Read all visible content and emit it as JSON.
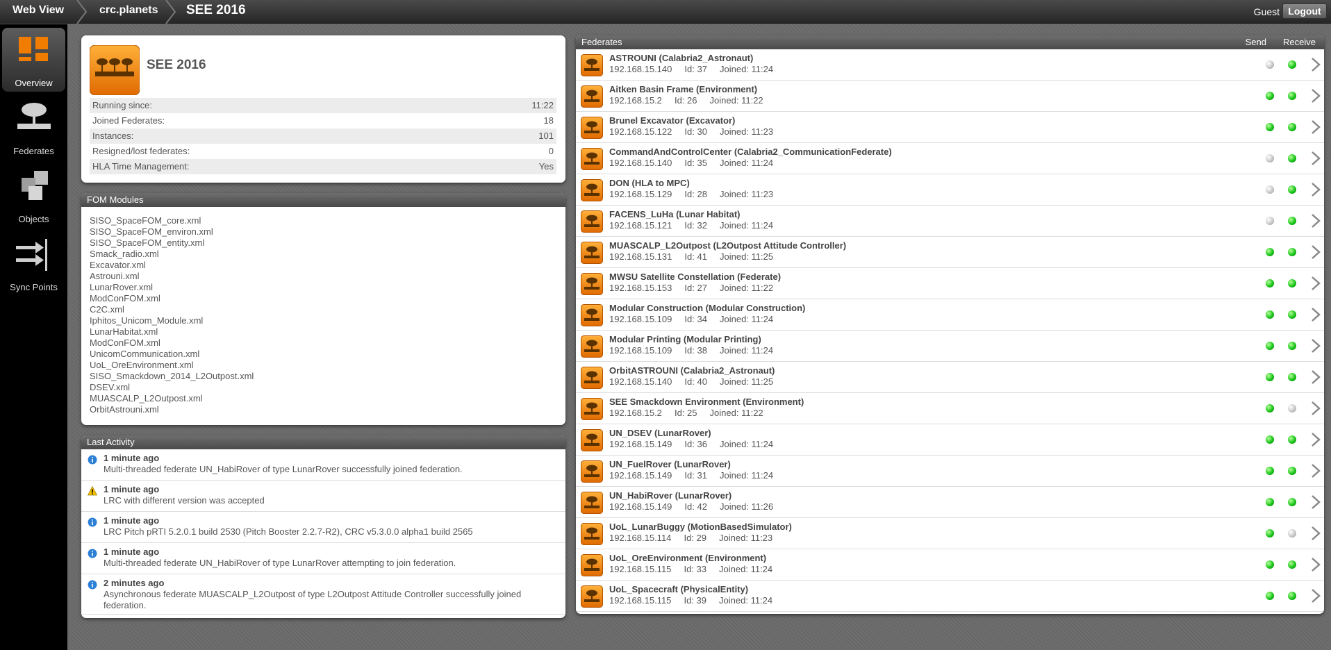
{
  "header": {
    "breadcrumbs": [
      "Web View",
      "crc.planets",
      "SEE 2016"
    ],
    "user_label": "Guest",
    "logout_label": "Logout"
  },
  "sidebar": {
    "items": [
      {
        "label": "Overview",
        "icon": "overview-icon",
        "active": true
      },
      {
        "label": "Federates",
        "icon": "federate-icon",
        "active": false
      },
      {
        "label": "Objects",
        "icon": "objects-icon",
        "active": false
      },
      {
        "label": "Sync Points",
        "icon": "sync-points-icon",
        "active": false
      }
    ]
  },
  "summary": {
    "title": "SEE 2016",
    "stats": [
      {
        "label": "Running since:",
        "value": "11:22"
      },
      {
        "label": "Joined Federates:",
        "value": "18"
      },
      {
        "label": "Instances:",
        "value": "101"
      },
      {
        "label": "Resigned/lost federates:",
        "value": "0"
      },
      {
        "label": "HLA Time Management:",
        "value": "Yes"
      }
    ]
  },
  "fom": {
    "title": "FOM Modules",
    "modules": [
      "SISO_SpaceFOM_core.xml",
      "SISO_SpaceFOM_environ.xml",
      "SISO_SpaceFOM_entity.xml",
      "Smack_radio.xml",
      "Excavator.xml",
      "Astrouni.xml",
      "LunarRover.xml",
      "ModConFOM.xml",
      "C2C.xml",
      "Iphitos_Unicom_Module.xml",
      "LunarHabitat.xml",
      "ModConFOM.xml",
      "UnicomCommunication.xml",
      "UoL_OreEnvironment.xml",
      "SISO_Smackdown_2014_L2Outpost.xml",
      "DSEV.xml",
      "MUASCALP_L2Outpost.xml",
      "OrbitAstrouni.xml"
    ]
  },
  "activity": {
    "title": "Last Activity",
    "items": [
      {
        "type": "info",
        "time": "1 minute ago",
        "message": "Multi-threaded federate UN_HabiRover of type LunarRover successfully joined federation."
      },
      {
        "type": "warning",
        "time": "1 minute ago",
        "message": "LRC with different version was accepted"
      },
      {
        "type": "info",
        "time": "1 minute ago",
        "message": "LRC Pitch pRTI 5.2.0.1 build 2530 (Pitch Booster 2.2.7-R2), CRC v5.3.0.0 alpha1 build 2565"
      },
      {
        "type": "info",
        "time": "1 minute ago",
        "message": "Multi-threaded federate UN_HabiRover of type LunarRover attempting to join federation."
      },
      {
        "type": "info",
        "time": "2 minutes ago",
        "message": "Asynchronous federate MUASCALP_L2Outpost of type L2Outpost Attitude Controller successfully joined federation."
      }
    ]
  },
  "federates": {
    "title": "Federates",
    "send_label": "Send",
    "receive_label": "Receive",
    "items": [
      {
        "name": "ASTROUNI (Calabria2_Astronaut)",
        "details": "192.168.15.140     Id: 37     Joined: 11:24",
        "send": "gray",
        "receive": "green"
      },
      {
        "name": "Aitken Basin Frame (Environment)",
        "details": "192.168.15.2     Id: 26     Joined: 11:22",
        "send": "green",
        "receive": "green"
      },
      {
        "name": "Brunel Excavator (Excavator)",
        "details": "192.168.15.122     Id: 30     Joined: 11:23",
        "send": "green",
        "receive": "green"
      },
      {
        "name": "CommandAndControlCenter (Calabria2_CommunicationFederate)",
        "details": "192.168.15.140     Id: 35     Joined: 11:24",
        "send": "gray",
        "receive": "green"
      },
      {
        "name": "DON (HLA to MPC)",
        "details": "192.168.15.129     Id: 28     Joined: 11:23",
        "send": "gray",
        "receive": "green"
      },
      {
        "name": "FACENS_LuHa (Lunar Habitat)",
        "details": "192.168.15.121     Id: 32     Joined: 11:24",
        "send": "gray",
        "receive": "green"
      },
      {
        "name": "MUASCALP_L2Outpost (L2Outpost Attitude Controller)",
        "details": "192.168.15.131     Id: 41     Joined: 11:25",
        "send": "green",
        "receive": "green"
      },
      {
        "name": "MWSU Satellite Constellation (Federate)",
        "details": "192.168.15.153     Id: 27     Joined: 11:22",
        "send": "green",
        "receive": "green"
      },
      {
        "name": "Modular Construction (Modular Construction)",
        "details": "192.168.15.109     Id: 34     Joined: 11:24",
        "send": "green",
        "receive": "green"
      },
      {
        "name": "Modular Printing (Modular Printing)",
        "details": "192.168.15.109     Id: 38     Joined: 11:24",
        "send": "green",
        "receive": "green"
      },
      {
        "name": "OrbitASTROUNI (Calabria2_Astronaut)",
        "details": "192.168.15.140     Id: 40     Joined: 11:25",
        "send": "green",
        "receive": "green"
      },
      {
        "name": "SEE Smackdown Environment (Environment)",
        "details": "192.168.15.2     Id: 25     Joined: 11:22",
        "send": "green",
        "receive": "gray"
      },
      {
        "name": "UN_DSEV (LunarRover)",
        "details": "192.168.15.149     Id: 36     Joined: 11:24",
        "send": "green",
        "receive": "green"
      },
      {
        "name": "UN_FuelRover (LunarRover)",
        "details": "192.168.15.149     Id: 31     Joined: 11:24",
        "send": "green",
        "receive": "green"
      },
      {
        "name": "UN_HabiRover (LunarRover)",
        "details": "192.168.15.149     Id: 42     Joined: 11:26",
        "send": "green",
        "receive": "green"
      },
      {
        "name": "UoL_LunarBuggy (MotionBasedSimulator)",
        "details": "192.168.15.114     Id: 29     Joined: 11:23",
        "send": "green",
        "receive": "gray"
      },
      {
        "name": "UoL_OreEnvironment (Environment)",
        "details": "192.168.15.115     Id: 33     Joined: 11:24",
        "send": "green",
        "receive": "green"
      },
      {
        "name": "UoL_Spacecraft (PhysicalEntity)",
        "details": "192.168.15.115     Id: 39     Joined: 11:24",
        "send": "green",
        "receive": "green"
      }
    ]
  },
  "colors": {
    "accent_orange": "#f07d00",
    "led_green": "#19c519",
    "led_gray": "#c8c8c8"
  }
}
